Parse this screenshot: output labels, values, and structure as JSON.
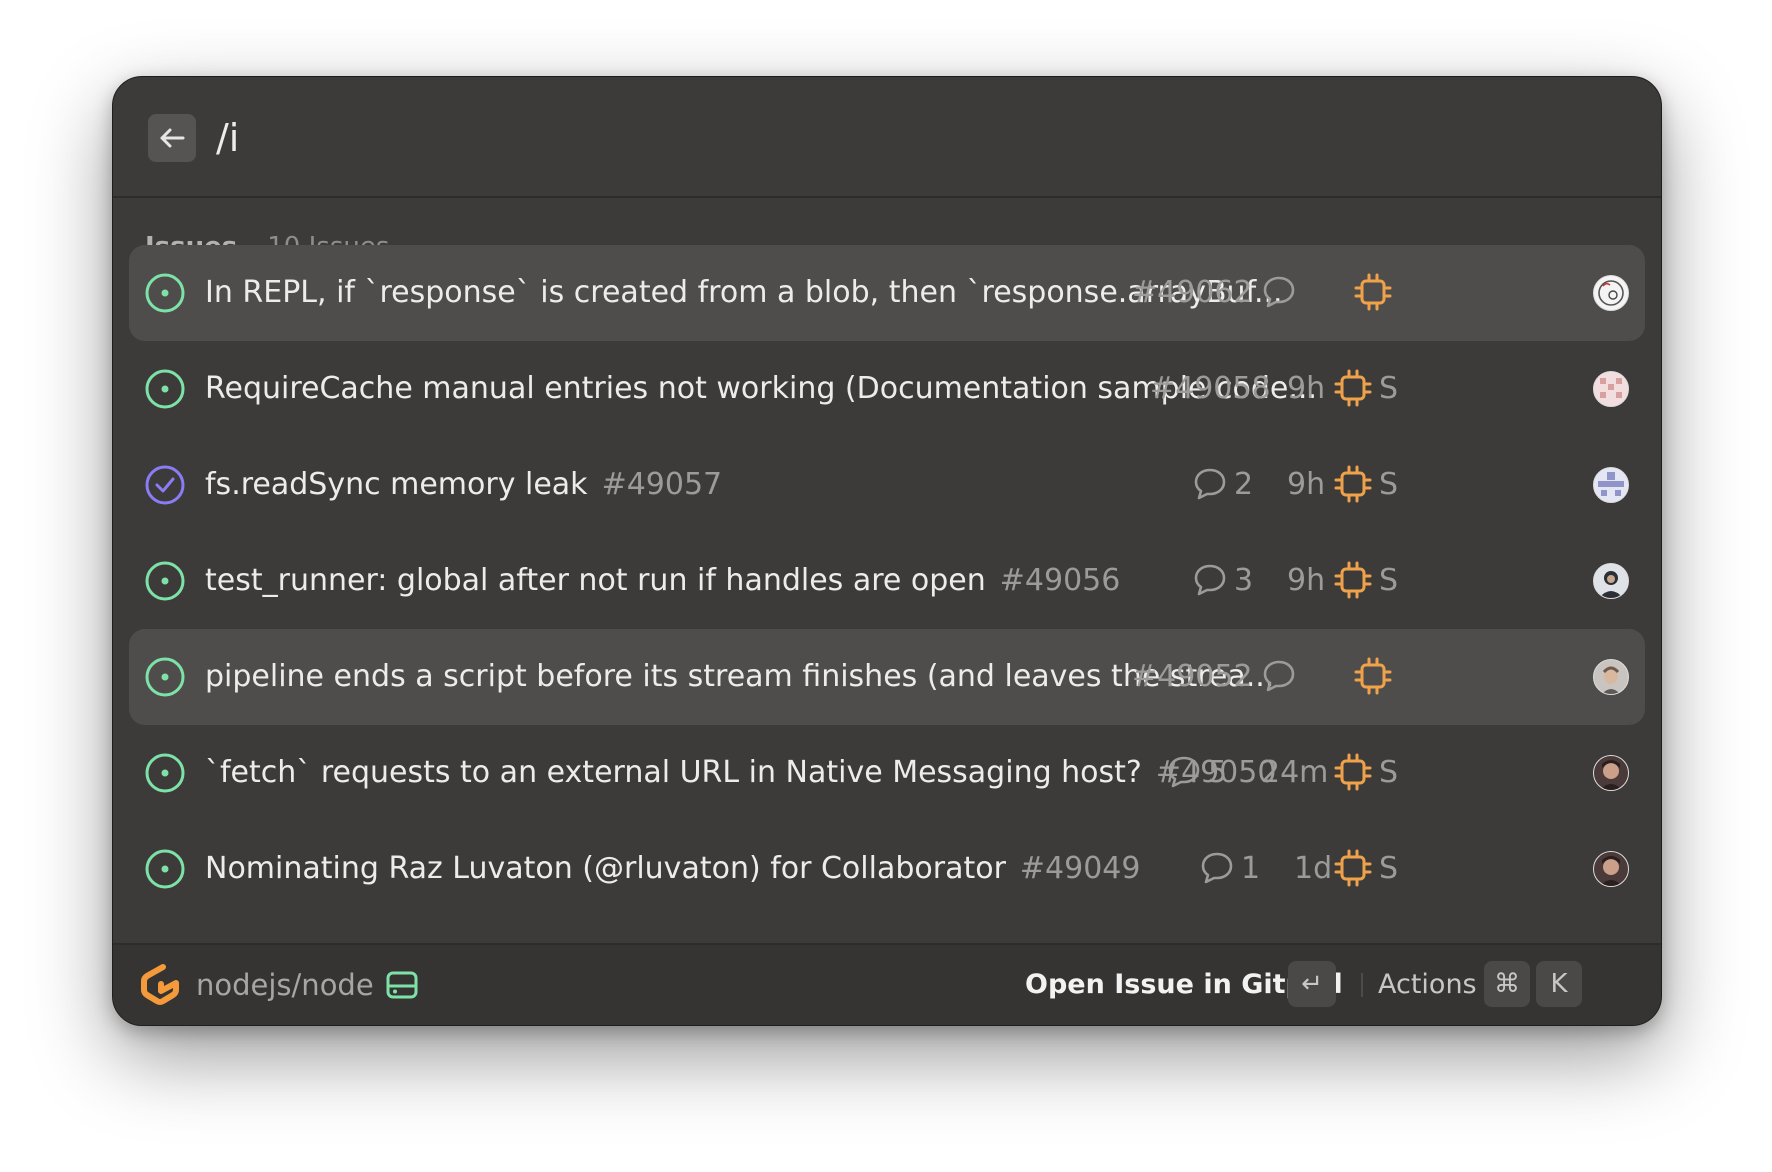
{
  "search": {
    "query": "/i"
  },
  "section": {
    "title": "Issues",
    "count": "10 Issues"
  },
  "issues": [
    {
      "title": "In REPL, if `response` is created from a blob, then `response.arrayBuf...",
      "number": "#49062",
      "comments": "",
      "age": "",
      "size": "",
      "status": "open"
    },
    {
      "title": "RequireCache manual entries not working (Documentation sample code...",
      "number": "#49058",
      "comments": "",
      "age": "9h",
      "size": "S",
      "status": "open"
    },
    {
      "title": "fs.readSync memory leak",
      "number": "#49057",
      "comments": "2",
      "age": "9h",
      "size": "S",
      "status": "closed"
    },
    {
      "title": "test_runner: global after not run if handles are open",
      "number": "#49056",
      "comments": "3",
      "age": "9h",
      "size": "S",
      "status": "open"
    },
    {
      "title": "pipeline ends a script before its stream finishes (and leaves the strea...",
      "number": "#49052",
      "comments": "",
      "age": "",
      "size": "",
      "status": "open"
    },
    {
      "title": "`fetch` requests to an external URL in Native Messaging host?",
      "number": "#49050",
      "comments": "5",
      "age": "24m",
      "size": "S",
      "status": "open"
    },
    {
      "title": "Nominating Raz Luvaton (@rluvaton) for Collaborator",
      "number": "#49049",
      "comments": "1",
      "age": "1d",
      "size": "S",
      "status": "open"
    }
  ],
  "footer": {
    "repo": "nodejs/node",
    "primary_action": "Open Issue in Gitpod",
    "enter_key": "↵",
    "actions_label": "Actions",
    "cmd_key": "⌘",
    "k_key": "K"
  },
  "colors": {
    "open": "#7ee2a8",
    "closed": "#8a7cf5",
    "chip": "#f0a24a",
    "logo": "#f59a3b"
  }
}
